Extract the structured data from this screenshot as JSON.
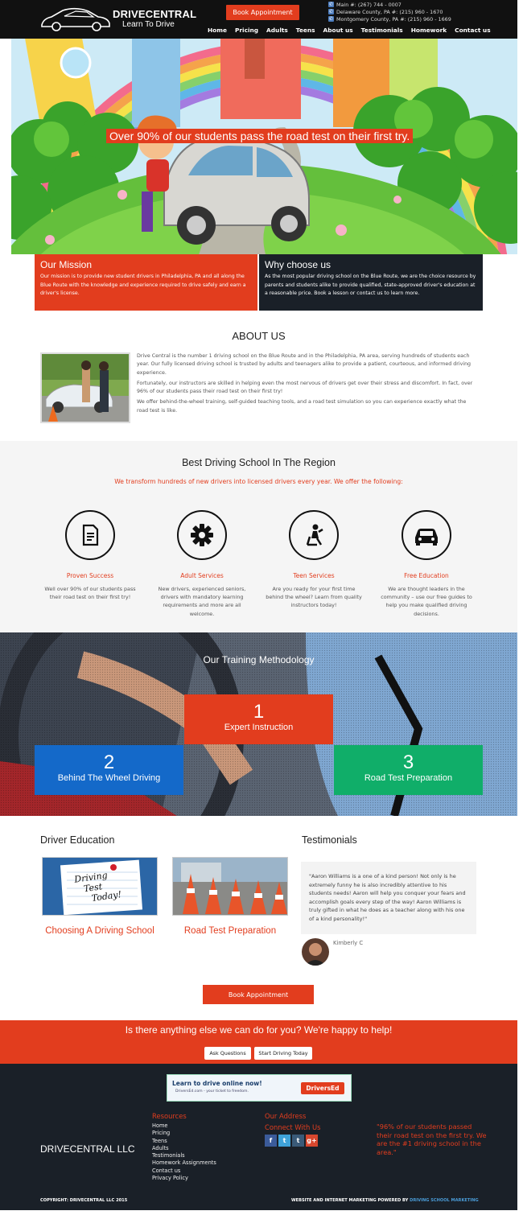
{
  "header": {
    "brand": "DRIVECENTRAL",
    "tagline": "Learn To Drive",
    "book_label": "Book Appointment",
    "contacts": [
      "Main #: (267) 744 - 0007",
      "Delaware County, PA #: (215) 960 - 1670",
      "Montgomery County, PA #: (215) 960 - 1669"
    ],
    "nav": [
      "Home",
      "Pricing",
      "Adults",
      "Teens",
      "About us",
      "Testimonials",
      "Homework",
      "Contact us"
    ]
  },
  "hero": {
    "caption": "Over 90% of our students pass the road test on their first try."
  },
  "mission": {
    "title": "Our Mission",
    "text": "Our mission is to provide new student drivers in Philadelphia, PA and all along the Blue Route with the knowledge and experience required to drive safely and earn a driver's license."
  },
  "why": {
    "title": "Why choose us",
    "text": "As the most popular driving school on the Blue Route, we are the choice resource by parents and students alike to provide qualified, state-approved driver's education at a reasonable price. Book a lesson or contact us to learn more."
  },
  "about": {
    "title": "ABOUT US",
    "p1": "Drive Central is the number 1 driving school on the Blue Route and in the Philadelphia, PA area, serving hundreds of students each year. Our fully licensed driving school is trusted by adults and teenagers alike to provide a patient, courteous, and informed driving experience.",
    "p2": "Fortunately, our instructors are skilled in helping even the most nervous of drivers get over their stress and discomfort. In fact, over 96% of our students pass their road test on their first try!",
    "p3": "We offer behind-the-wheel training, self-guided teaching tools, and a road test simulation so you can experience exactly what the road test is like."
  },
  "best": {
    "title": "Best Driving School In The Region",
    "subtitle": "We transform hundreds of new drivers into licensed drivers every year. We offer the following:",
    "features": [
      {
        "title": "Proven Success",
        "text": "Well over 90% of our students pass their road test on their first try!",
        "icon": "document-icon"
      },
      {
        "title": "Adult Services",
        "text": "New drivers, experienced seniors, drivers with mandatory learning requirements and more are all welcome.",
        "icon": "gear-icon"
      },
      {
        "title": "Teen Services",
        "text": "Are you ready for your first time behind the wheel? Learn from quality instructors today!",
        "icon": "driver-seat-icon"
      },
      {
        "title": "Free Education",
        "text": "We are thought leaders in the community – use our free guides to help you make qualified driving decisions.",
        "icon": "car-icon"
      }
    ]
  },
  "method": {
    "title": "Our Training Methodology",
    "steps": [
      {
        "num": "1",
        "label": "Expert Instruction",
        "color": "#e23d1e"
      },
      {
        "num": "2",
        "label": "Behind The Wheel Driving",
        "color": "#1469c9"
      },
      {
        "num": "3",
        "label": "Road Test Preparation",
        "color": "#10ae69"
      }
    ]
  },
  "education": {
    "title": "Driver Education",
    "items": [
      "Choosing A Driving School",
      "Road Test Preparation"
    ],
    "note_text": "Driving Test Today!"
  },
  "testimonials": {
    "title": "Testimonials",
    "quote": "\"Aaron Williams is a one of a kind person! Not only is he extremely funny he is also incredibly attentive to his students needs! Aaron will help you conquer your fears and accomplish goals every step of the way! Aaron Williams is truly gifted in what he does as a teacher along with his one of a kind personality!\"",
    "author": "Kimberly C"
  },
  "book2_label": "Book Appointment",
  "cta": {
    "text": "Is there anything else we can do for you? We're happy to help!",
    "buttons": [
      "Ask Questions",
      "Start Driving Today"
    ]
  },
  "footer": {
    "banner_text": "Learn to drive online now!",
    "banner_small": "DriversEd.com - your ticket to freedom.",
    "banner_logo": "DriversEd",
    "company": "DRIVECENTRAL LLC",
    "resources_title": "Resources",
    "resources": [
      "Home",
      "Pricing",
      "Teens",
      "Adults",
      "Testimonials",
      "Homework Assignments",
      "Contact us",
      "Privacy Policy"
    ],
    "address_title": "Our Address",
    "connect_title": "Connect With Us",
    "social": [
      "f",
      "t",
      "t",
      "g+"
    ],
    "quote": "\"96% of our students passed their road test on the first try. We are the #1 driving school in the area.\"",
    "copyright": "COPYRIGHT: DRIVECENTRAL LLC 2015",
    "powered_prefix": "WEBSITE AND INTERNET MARKETING POWERED BY",
    "powered_link": "DRIVING SCHOOL MARKETING"
  },
  "colors": {
    "accent": "#e23d1e",
    "dark": "#1a2028",
    "blue": "#1469c9",
    "green": "#10ae69"
  }
}
